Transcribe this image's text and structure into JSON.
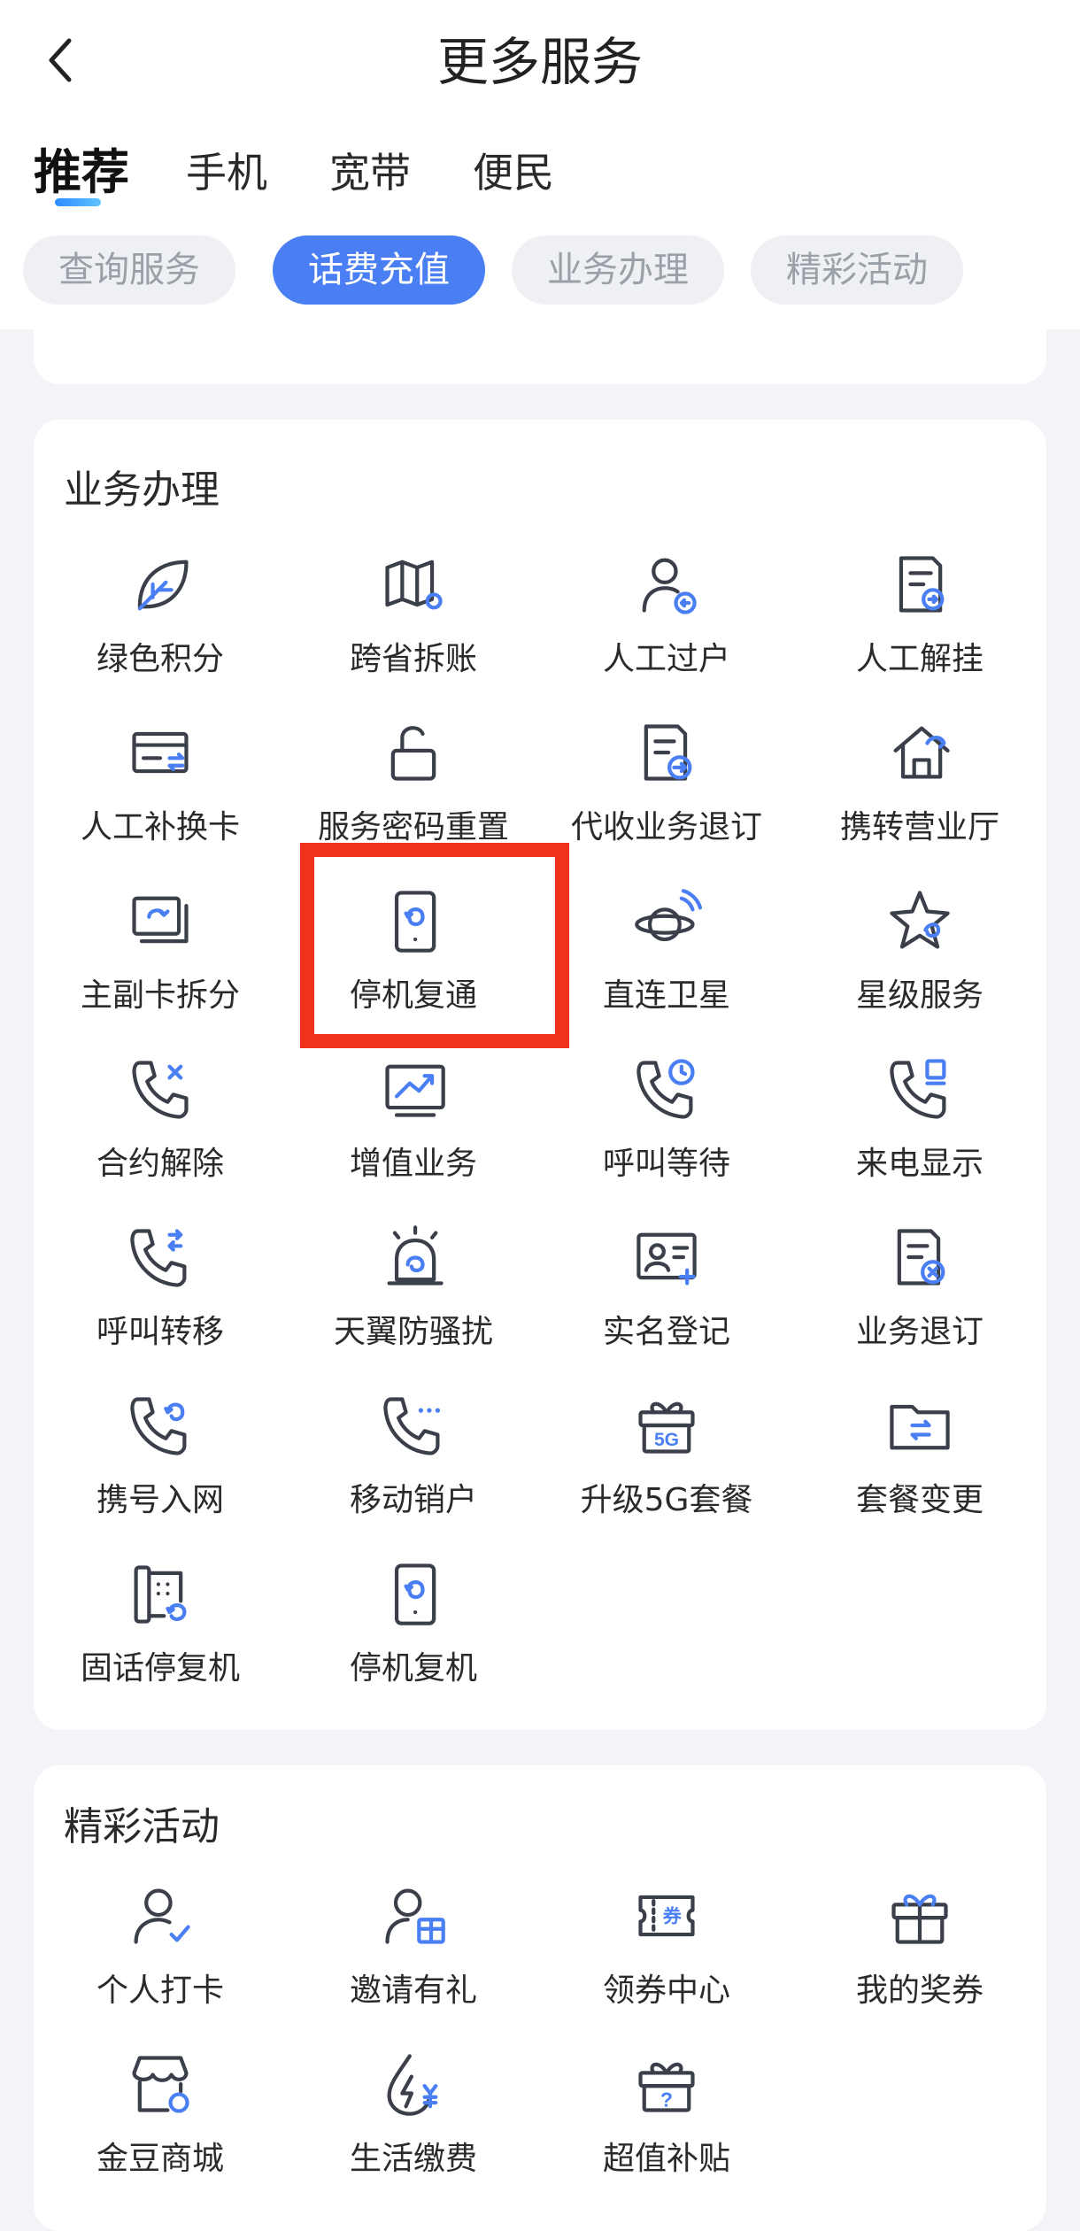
{
  "header": {
    "title": "更多服务",
    "main_tabs": [
      {
        "label": "推荐",
        "active": true
      },
      {
        "label": "手机",
        "active": false
      },
      {
        "label": "宽带",
        "active": false
      },
      {
        "label": "便民",
        "active": false
      }
    ],
    "chips": [
      {
        "label": "查询服务",
        "active": false
      },
      {
        "label": "话费充值",
        "active": true
      },
      {
        "label": "业务办理",
        "active": false
      },
      {
        "label": "精彩活动",
        "active": false
      }
    ]
  },
  "colors": {
    "accent": "#4a7ef3",
    "icon_stroke": "#3a3f4a",
    "icon_accent": "#4a7ef3",
    "highlight": "#f0311c"
  },
  "business": {
    "title": "业务办理",
    "items": [
      {
        "label": "绿色积分",
        "icon": "leaf-icon"
      },
      {
        "label": "跨省拆账",
        "icon": "map-pin-icon"
      },
      {
        "label": "人工过户",
        "icon": "user-transfer-icon"
      },
      {
        "label": "人工解挂",
        "icon": "document-arrow-icon"
      },
      {
        "label": "人工补换卡",
        "icon": "card-swap-icon"
      },
      {
        "label": "服务密码重置",
        "icon": "unlock-icon"
      },
      {
        "label": "代收业务退订",
        "icon": "document-exit-icon"
      },
      {
        "label": "携转营业厅",
        "icon": "home-transfer-icon"
      },
      {
        "label": "主副卡拆分",
        "icon": "cards-split-icon"
      },
      {
        "label": "停机复通",
        "icon": "phone-restore-icon"
      },
      {
        "label": "直连卫星",
        "icon": "satellite-planet-icon"
      },
      {
        "label": "星级服务",
        "icon": "star-icon"
      },
      {
        "label": "合约解除",
        "icon": "phone-cancel-icon"
      },
      {
        "label": "增值业务",
        "icon": "trend-chart-icon"
      },
      {
        "label": "呼叫等待",
        "icon": "phone-clock-icon"
      },
      {
        "label": "来电显示",
        "icon": "phone-display-icon"
      },
      {
        "label": "呼叫转移",
        "icon": "phone-forward-icon"
      },
      {
        "label": "天翼防骚扰",
        "icon": "alarm-shield-icon"
      },
      {
        "label": "实名登记",
        "icon": "id-card-icon"
      },
      {
        "label": "业务退订",
        "icon": "document-cancel-icon"
      },
      {
        "label": "携号入网",
        "icon": "phone-port-icon"
      },
      {
        "label": "移动销户",
        "icon": "phone-more-icon"
      },
      {
        "label": "升级5G套餐",
        "icon": "gift-5g-icon"
      },
      {
        "label": "套餐变更",
        "icon": "folder-swap-icon"
      },
      {
        "label": "固话停复机",
        "icon": "landline-restore-icon"
      },
      {
        "label": "停机复机",
        "icon": "phone-restore-icon"
      }
    ]
  },
  "activities": {
    "title": "精彩活动",
    "items": [
      {
        "label": "个人打卡",
        "icon": "user-check-icon"
      },
      {
        "label": "邀请有礼",
        "icon": "user-gift-icon"
      },
      {
        "label": "领券中心",
        "icon": "coupon-icon"
      },
      {
        "label": "我的奖券",
        "icon": "gift-icon"
      },
      {
        "label": "金豆商城",
        "icon": "shop-icon"
      },
      {
        "label": "生活缴费",
        "icon": "utility-pay-icon"
      },
      {
        "label": "超值补贴",
        "icon": "mystery-gift-icon"
      }
    ]
  }
}
